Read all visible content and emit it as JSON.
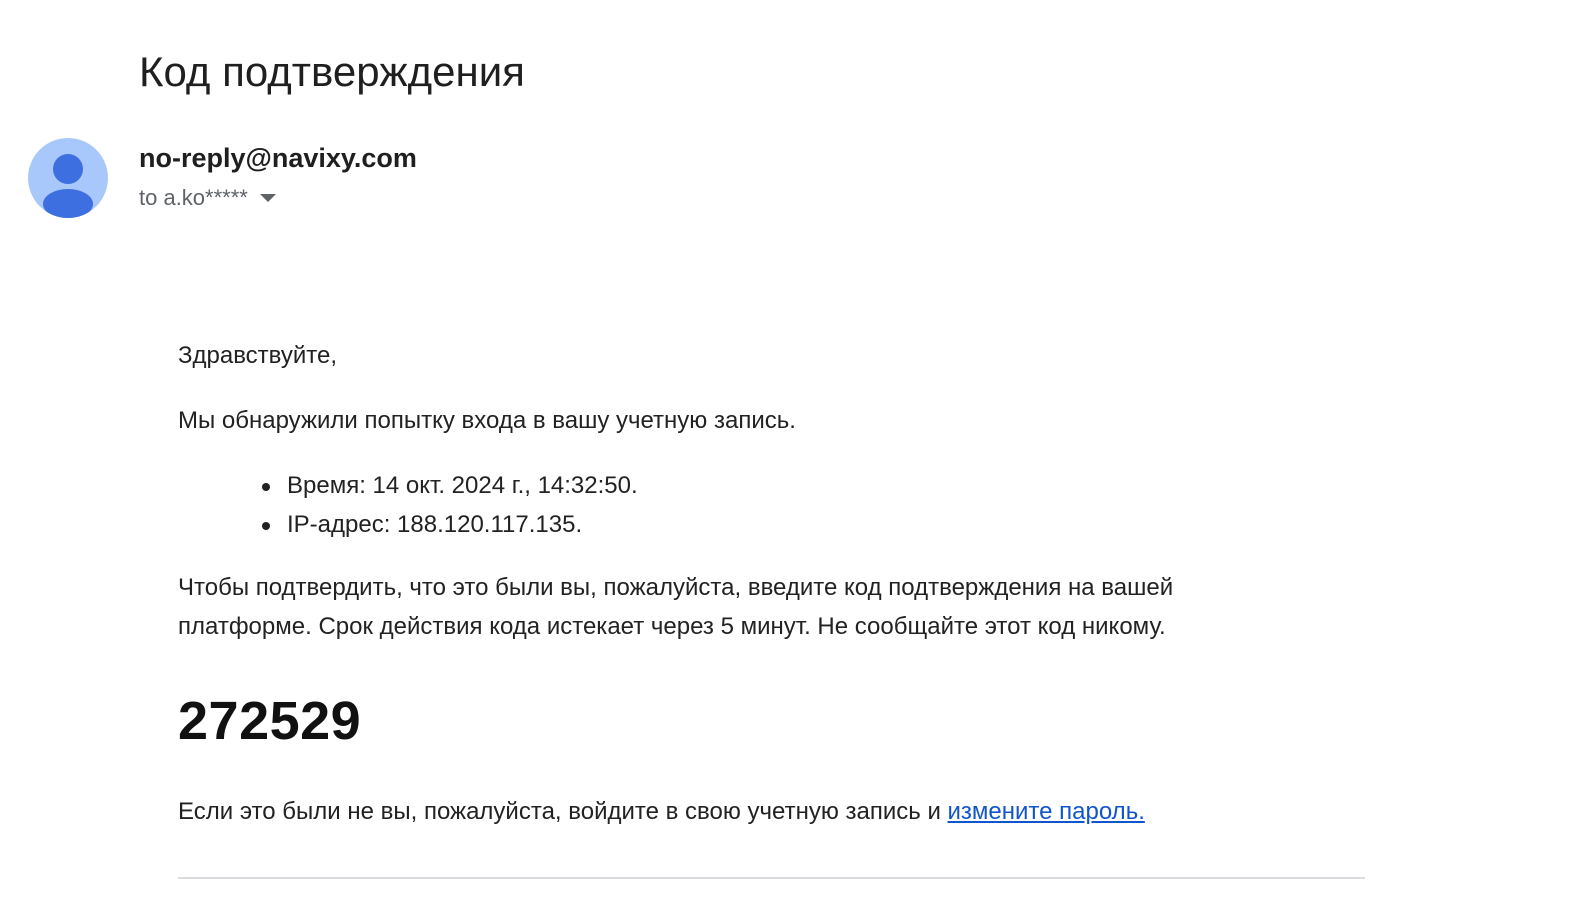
{
  "email": {
    "subject": "Код подтверждения",
    "sender": "no-reply@navixy.com",
    "recipient": "to a.ko*****",
    "avatar_icon": "person-avatar-icon",
    "dropdown_icon": "caret-down-icon",
    "colors": {
      "avatar_bg": "#a8c7fa",
      "avatar_figure": "#3d6fe0",
      "link": "#1155cc"
    }
  },
  "message": {
    "greeting": "Здравствуйте,",
    "intro": "Мы обнаружили попытку входа в вашу учетную запись.",
    "details": [
      "Время: 14 окт. 2024 г., 14:32:50.",
      "IP-адрес: 188.120.117.135."
    ],
    "instructions": "Чтобы подтвердить, что это были вы, пожалуйста, введите код подтверждения на вашей платформе. Срок действия кода истекает через 5 минут. Не сообщайте этот код никому.",
    "code": "272529",
    "footer_text": "Если это были не вы, пожалуйста, войдите в свою учетную запись и ",
    "footer_link": "измените пароль."
  }
}
